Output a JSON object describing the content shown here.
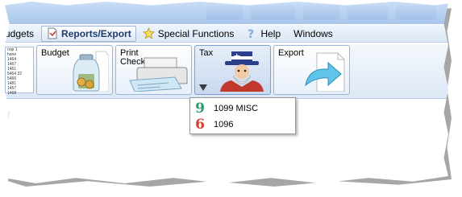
{
  "menubar": {
    "items": [
      {
        "label": "udgets",
        "icon": "none"
      },
      {
        "label": "Reports/Export",
        "icon": "report-icon",
        "active": true
      },
      {
        "label": "Special Functions",
        "icon": "star-icon"
      },
      {
        "label": "Help",
        "icon": "help-icon"
      },
      {
        "label": "Windows",
        "icon": "none"
      }
    ]
  },
  "toolbar": {
    "mini_report_lines": [
      "roip 1",
      "hone ",
      "1464 ",
      "1467 ",
      "1461 ",
      "",
      "5464 22",
      "5466 ",
      "1481 ",
      "1457 ",
      "1468 "
    ],
    "buttons": [
      {
        "label": "Budget",
        "icon": "money-jar-icon"
      },
      {
        "label": "Print\nChecks",
        "icon": "check-printer-icon"
      },
      {
        "label": "Tax",
        "icon": "uncle-sam-icon",
        "selected": true
      },
      {
        "label": "Export",
        "icon": "export-arrow-icon"
      }
    ]
  },
  "dropdown": {
    "items": [
      {
        "label": "1099 MISC",
        "glyph": "9",
        "color": "#2a9d6e"
      },
      {
        "label": "1096",
        "glyph": "6",
        "color": "#d0412e"
      }
    ]
  }
}
